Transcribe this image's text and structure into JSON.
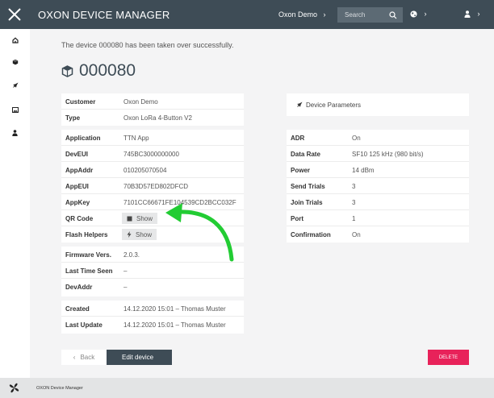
{
  "header": {
    "app_title": "OXON DEVICE MANAGER",
    "organization": "Oxon Demo",
    "search_placeholder": "Search"
  },
  "sidebar": {
    "items": [
      {
        "icon": "home-icon"
      },
      {
        "icon": "device-icon"
      },
      {
        "icon": "rocket-icon"
      },
      {
        "icon": "image-icon"
      },
      {
        "icon": "user-icon"
      }
    ]
  },
  "main": {
    "success_message": "The device 000080 has been taken over successfully.",
    "device_id": "000080",
    "general": [
      {
        "label": "Customer",
        "value": "Oxon Demo"
      },
      {
        "label": "Type",
        "value": "Oxon LoRa 4-Button V2"
      }
    ],
    "lora": [
      {
        "label": "Application",
        "value": "TTN App"
      },
      {
        "label": "DevEUI",
        "value": "745BC3000000000"
      },
      {
        "label": "AppAddr",
        "value": "010205070504"
      },
      {
        "label": "AppEUI",
        "value": "70B3D57ED802DFCD"
      },
      {
        "label": "AppKey",
        "value": "7101CC66671FE104539CD2BCC032F"
      }
    ],
    "qr_code": {
      "label": "QR Code",
      "button": "Show"
    },
    "flash_helpers": {
      "label": "Flash Helpers",
      "button": "Show"
    },
    "status": [
      {
        "label": "Firmware Vers.",
        "value": "2.0.3."
      },
      {
        "label": "Last Time Seen",
        "value": "–"
      },
      {
        "label": "DevAddr",
        "value": "–"
      }
    ],
    "audit": [
      {
        "label": "Created",
        "value": "14.12.2020 15:01 – Thomas Muster"
      },
      {
        "label": "Last Update",
        "value": "14.12.2020 15:01 – Thomas Muster"
      }
    ],
    "params_title": "Device Parameters",
    "params": [
      {
        "label": "ADR",
        "value": "On"
      },
      {
        "label": "Data Rate",
        "value": "SF10 125 kHz (980 bit/s)"
      },
      {
        "label": "Power",
        "value": "14 dBm"
      },
      {
        "label": "Send Trials",
        "value": "3"
      },
      {
        "label": "Join Trials",
        "value": "3"
      },
      {
        "label": "Port",
        "value": "1"
      },
      {
        "label": "Confirmation",
        "value": "On"
      }
    ],
    "back_label": "Back",
    "edit_label": "Edit device",
    "delete_label": "DELETE"
  },
  "footer": {
    "text": "OXON Device Manager"
  },
  "colors": {
    "header": "#3e4c56",
    "accent_delete": "#e8225a",
    "arrow": "#22cc33"
  }
}
